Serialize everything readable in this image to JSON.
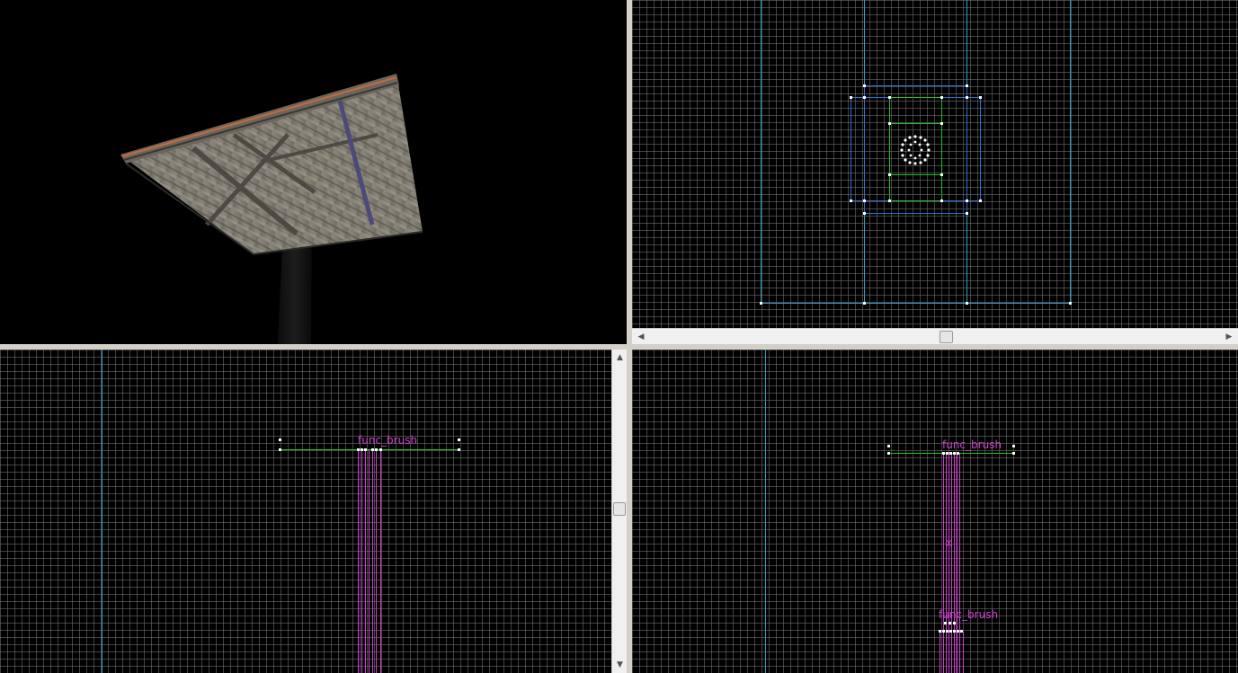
{
  "viewports": {
    "camera_3d": {
      "name": "3d-camera-view"
    },
    "top": {
      "name": "top-2d-view"
    },
    "front": {
      "name": "front-2d-view",
      "entity_label": "func_brush"
    },
    "side": {
      "name": "side-2d-view",
      "entity_label_upper": "func_brush",
      "entity_label_lower": "func_brush"
    }
  },
  "colors": {
    "background": "#000000",
    "grid": "#7a7a7a",
    "axis": "#00a0a0",
    "brush_outline": "#2f8fd8",
    "selected_brush": "#20c020",
    "entity": "#e040e0",
    "handle": "#ffffff"
  },
  "scrollbars": {
    "horizontal": {
      "arrow_left": "◀",
      "arrow_right": "▶"
    },
    "vertical": {
      "arrow_up": "▲",
      "arrow_down": "▼"
    }
  }
}
